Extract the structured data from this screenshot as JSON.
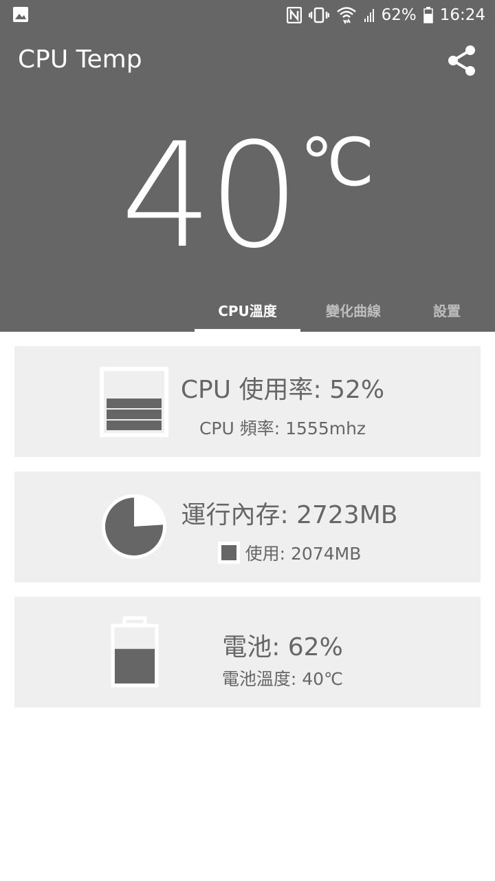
{
  "status_bar": {
    "battery_percent_text": "62%",
    "time": "16:24",
    "icons": [
      "image-icon",
      "nfc-icon",
      "vibrate-icon",
      "wifi-icon",
      "signal-icon",
      "battery-icon"
    ]
  },
  "app_bar": {
    "title": "CPU Temp",
    "share_icon": "share-icon"
  },
  "temperature": {
    "value": "40",
    "unit": "℃"
  },
  "tabs": [
    {
      "label": "CPU溫度",
      "active": true
    },
    {
      "label": "變化曲線",
      "active": false
    },
    {
      "label": "設置",
      "active": false
    }
  ],
  "cards": {
    "cpu": {
      "title": "CPU 使用率: 52%",
      "sub": "CPU 頻率: 1555mhz",
      "icon": "cpu-bars-icon"
    },
    "memory": {
      "title": "運行內存: 2723MB",
      "sub": "使用: 2074MB",
      "icon": "memory-pie-icon",
      "used_fraction": 0.76
    },
    "battery": {
      "title": "電池: 62%",
      "sub": "電池溫度: 40℃",
      "icon": "battery-level-icon",
      "level_fraction": 0.62
    }
  },
  "colors": {
    "header": "#666666",
    "card": "#efefef",
    "accent": "#ffffff",
    "text": "#666666",
    "inactive_tab": "#bdbdbd"
  }
}
